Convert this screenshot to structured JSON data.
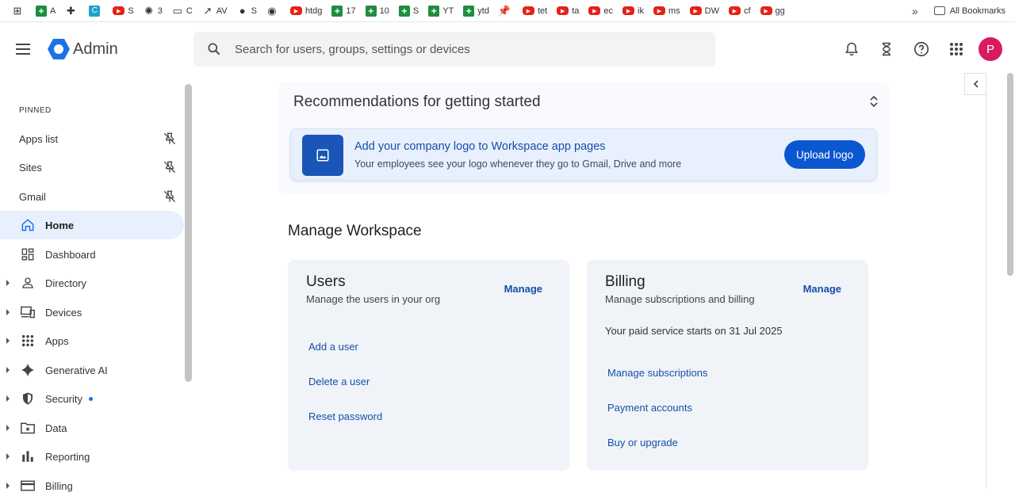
{
  "bookmarks": [
    {
      "icon": "apps-grid-icon",
      "label": ""
    },
    {
      "icon": "sheets-icon",
      "label": "A"
    },
    {
      "icon": "puzzle-icon",
      "label": ""
    },
    {
      "icon": "canva-icon",
      "label": ""
    },
    {
      "icon": "youtube-icon",
      "label": "S"
    },
    {
      "icon": "openai-icon",
      "label": "3"
    },
    {
      "icon": "folder-icon",
      "label": "C"
    },
    {
      "icon": "trend-icon",
      "label": "AV"
    },
    {
      "icon": "globe-icon",
      "label": "S"
    },
    {
      "icon": "github-icon",
      "label": ""
    },
    {
      "icon": "youtube-icon",
      "label": "htdg"
    },
    {
      "icon": "sheets-icon",
      "label": "17"
    },
    {
      "icon": "sheets-icon",
      "label": "10"
    },
    {
      "icon": "sheets-icon",
      "label": "S"
    },
    {
      "icon": "sheets-icon",
      "label": "YT"
    },
    {
      "icon": "sheets-icon",
      "label": "ytd"
    },
    {
      "icon": "pin-icon",
      "label": ""
    },
    {
      "icon": "youtube-icon",
      "label": "tet"
    },
    {
      "icon": "youtube-icon",
      "label": "ta"
    },
    {
      "icon": "youtube-icon",
      "label": "ec"
    },
    {
      "icon": "youtube-icon",
      "label": "ik"
    },
    {
      "icon": "youtube-icon",
      "label": "ms"
    },
    {
      "icon": "youtube-icon",
      "label": "DW"
    },
    {
      "icon": "youtube-icon",
      "label": "cf"
    },
    {
      "icon": "youtube-icon",
      "label": "gg"
    }
  ],
  "bookmarks_more": "»",
  "all_bookmarks": "All Bookmarks",
  "header": {
    "app_title": "Admin",
    "search_placeholder": "Search for users, groups, settings or devices",
    "avatar_letter": "P"
  },
  "sidebar": {
    "pinned_heading": "PINNED",
    "pinned": [
      "Apps list",
      "Sites",
      "Gmail"
    ],
    "nav": [
      {
        "label": "Home",
        "icon": "home-icon",
        "active": true,
        "expandable": false
      },
      {
        "label": "Dashboard",
        "icon": "dashboard-icon",
        "expandable": false
      },
      {
        "label": "Directory",
        "icon": "person-icon",
        "expandable": true
      },
      {
        "label": "Devices",
        "icon": "devices-icon",
        "expandable": true
      },
      {
        "label": "Apps",
        "icon": "apps-icon",
        "expandable": true
      },
      {
        "label": "Generative AI",
        "icon": "sparkle-icon",
        "expandable": true
      },
      {
        "label": "Security",
        "icon": "shield-icon",
        "expandable": true,
        "dot": true
      },
      {
        "label": "Data",
        "icon": "data-folder-icon",
        "expandable": true
      },
      {
        "label": "Reporting",
        "icon": "bar-chart-icon",
        "expandable": true
      },
      {
        "label": "Billing",
        "icon": "billing-icon",
        "expandable": true
      }
    ]
  },
  "recommendations": {
    "title": "Recommendations for getting started",
    "card_heading": "Add your company logo to Workspace app pages",
    "card_sub": "Your employees see your logo whenever they go to Gmail, Drive and more",
    "button": "Upload logo"
  },
  "manage": {
    "title": "Manage Workspace",
    "users": {
      "title": "Users",
      "subtitle": "Manage the users in your org",
      "manage": "Manage",
      "links": [
        "Add a user",
        "Delete a user",
        "Reset password"
      ]
    },
    "billing": {
      "title": "Billing",
      "subtitle": "Manage subscriptions and billing",
      "manage": "Manage",
      "note": "Your paid service starts on 31 Jul 2025",
      "links": [
        "Manage subscriptions",
        "Payment accounts",
        "Buy or upgrade"
      ]
    }
  },
  "colors": {
    "accent": "#0b57d0",
    "active_bg": "#e8f0fe",
    "avatar": "#d81b60"
  }
}
